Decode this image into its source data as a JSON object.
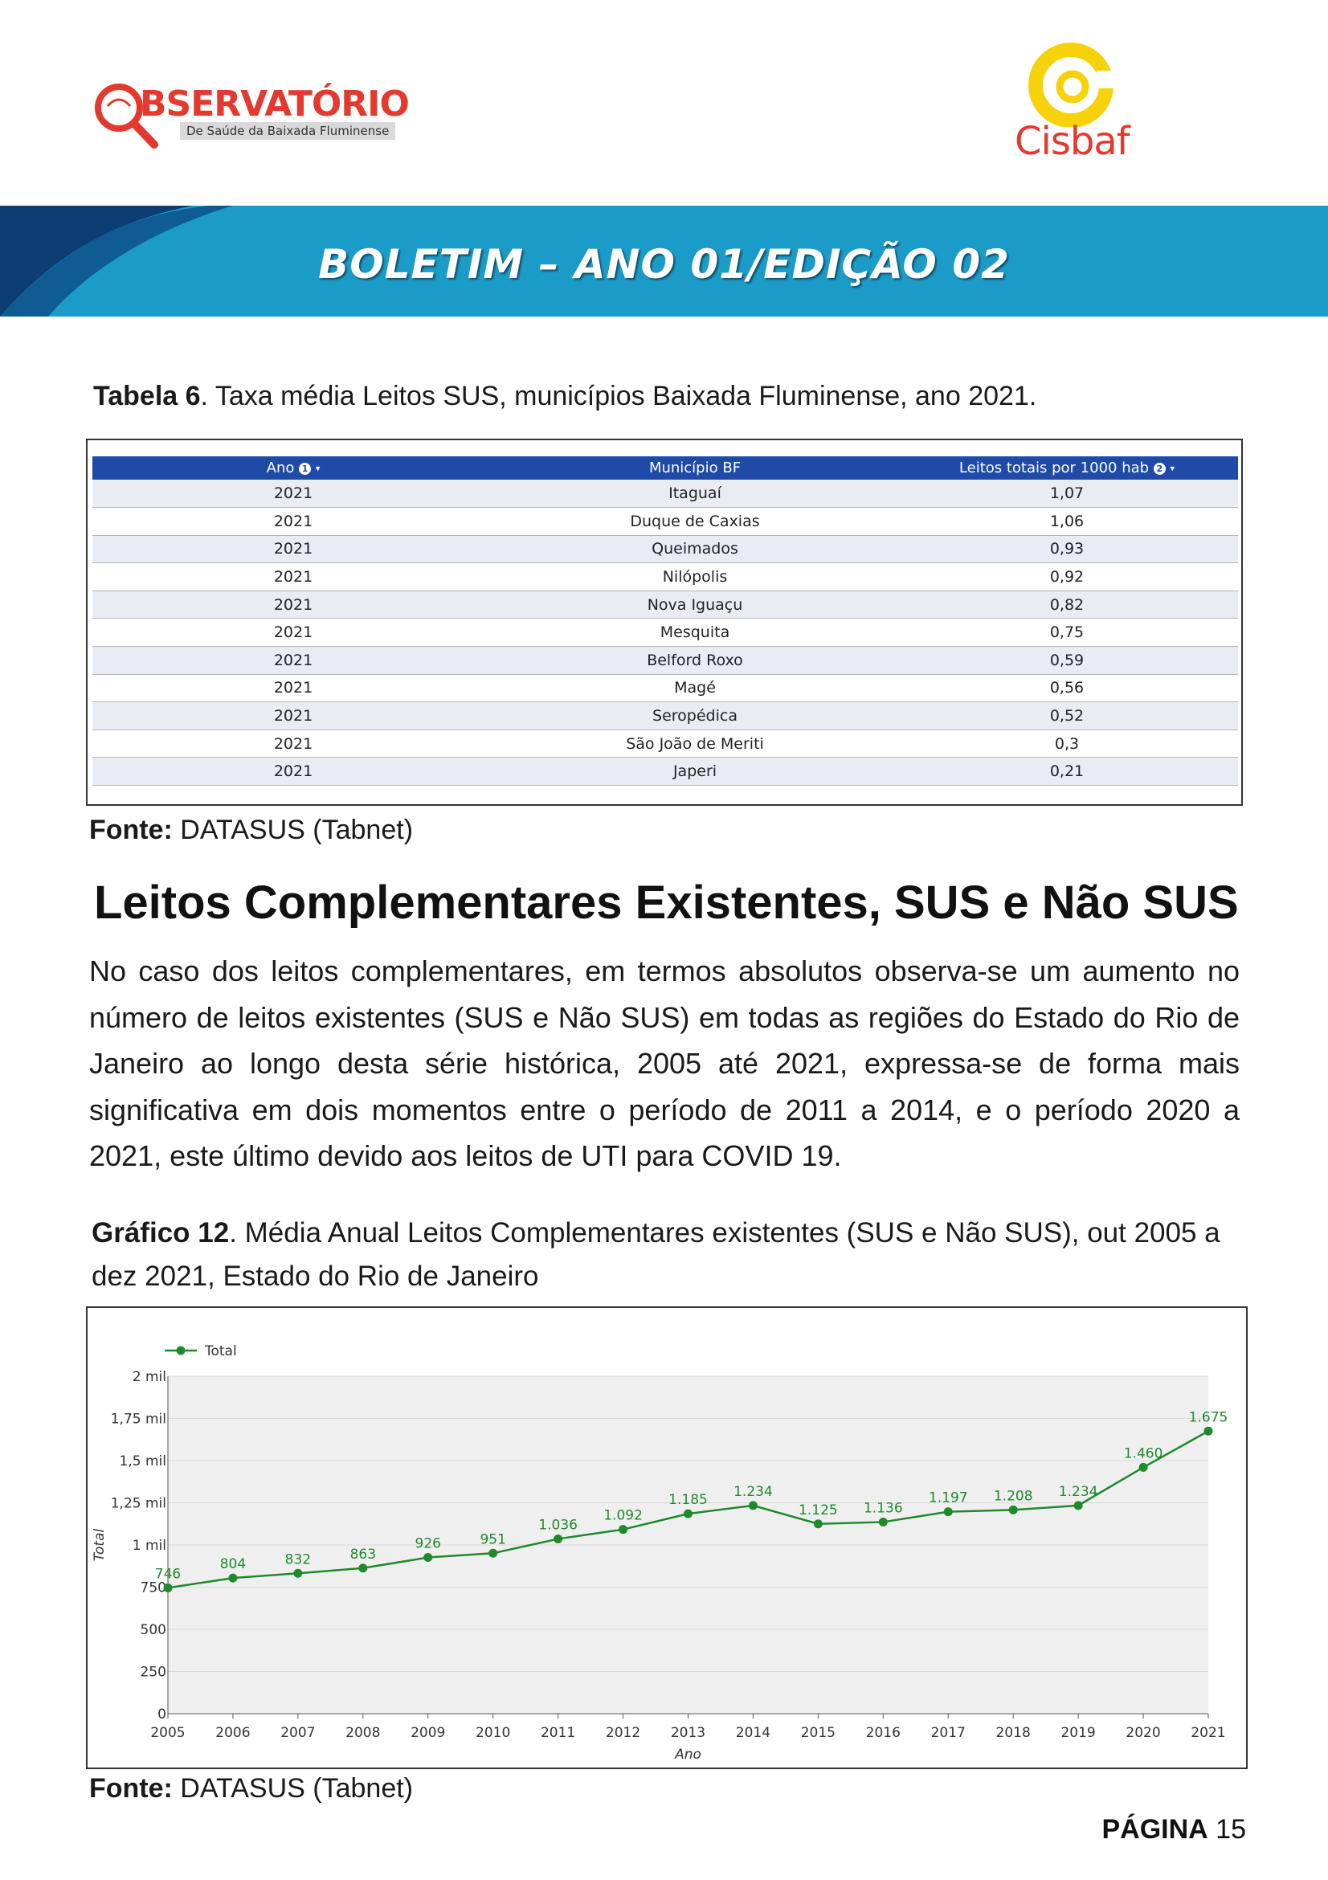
{
  "header": {
    "obs_title": "BSERVATÓRIO",
    "obs_subtitle": "De Saúde da Baixada Fluminense",
    "cisbaf": "Cisbaf",
    "banner": "BOLETIM – ANO 01/EDIÇÃO 02",
    "colors": {
      "red": "#e4392e",
      "blue": "#1b9bc8",
      "navy": "#0d3e73",
      "yellow": "#f5d20a"
    }
  },
  "table_section": {
    "caption_bold": "Tabela 6",
    "caption_rest": ". Taxa média Leitos SUS, municípios Baixada Fluminense, ano 2021.",
    "columns": [
      "Ano",
      "Município BF",
      "Leitos totais por 1000 hab"
    ],
    "column_badges": [
      "1",
      "",
      "2"
    ],
    "rows": [
      [
        "2021",
        "Itaguaí",
        "1,07"
      ],
      [
        "2021",
        "Duque de Caxias",
        "1,06"
      ],
      [
        "2021",
        "Queimados",
        "0,93"
      ],
      [
        "2021",
        "Nilópolis",
        "0,92"
      ],
      [
        "2021",
        "Nova Iguaçu",
        "0,82"
      ],
      [
        "2021",
        "Mesquita",
        "0,75"
      ],
      [
        "2021",
        "Belford Roxo",
        "0,59"
      ],
      [
        "2021",
        "Magé",
        "0,56"
      ],
      [
        "2021",
        "Seropédica",
        "0,52"
      ],
      [
        "2021",
        "São João de Meriti",
        "0,3"
      ],
      [
        "2021",
        "Japeri",
        "0,21"
      ]
    ],
    "header_color": "#1f4aa8",
    "source_bold": "Fonte:",
    "source_rest": " DATASUS (Tabnet)"
  },
  "section": {
    "heading": "Leitos Complementares Existentes, SUS e Não SUS",
    "paragraph": "No caso dos leitos complementares, em termos absolutos observa-se um aumento no número de leitos existentes (SUS e Não SUS) em todas as regiões do Estado do Rio de Janeiro ao longo desta série histórica, 2005 até 2021, expressa-se de forma mais significativa em dois momentos entre o período de 2011 a 2014,  e o período 2020 a 2021, este último devido aos leitos de UTI para COVID 19."
  },
  "chart_section": {
    "caption_bold": "Gráfico 12",
    "caption_rest": ". Média Anual Leitos Complementares existentes (SUS e Não SUS), out 2005 a dez 2021, Estado do Rio de Janeiro",
    "source_bold": "Fonte:",
    "source_rest": " DATASUS (Tabnet)"
  },
  "chart_data": {
    "type": "line",
    "x": [
      "2005",
      "2006",
      "2007",
      "2008",
      "2009",
      "2010",
      "2011",
      "2012",
      "2013",
      "2014",
      "2015",
      "2016",
      "2017",
      "2018",
      "2019",
      "2020",
      "2021"
    ],
    "series": [
      {
        "name": "Total",
        "values": [
          746,
          804,
          832,
          863,
          926,
          951,
          1036,
          1092,
          1185,
          1234,
          1125,
          1136,
          1197,
          1208,
          1234,
          1460,
          1675
        ],
        "labels": [
          "746",
          "804",
          "832",
          "863",
          "926",
          "951",
          "1.036",
          "1.092",
          "1.185",
          "1.234",
          "1.125",
          "1.136",
          "1.197",
          "1.208",
          "1.234",
          "1.460",
          "1.675"
        ],
        "color": "#1e8a2a"
      }
    ],
    "yticks": [
      {
        "value": 0,
        "label": "0"
      },
      {
        "value": 250,
        "label": "250"
      },
      {
        "value": 500,
        "label": "500"
      },
      {
        "value": 750,
        "label": "750"
      },
      {
        "value": 1000,
        "label": "1 mil"
      },
      {
        "value": 1250,
        "label": "1,25 mil"
      },
      {
        "value": 1500,
        "label": "1,5 mil"
      },
      {
        "value": 1750,
        "label": "1,75 mil"
      },
      {
        "value": 2000,
        "label": "2 mil"
      }
    ],
    "ylim": [
      0,
      2000
    ],
    "xlabel": "Ano",
    "ylabel": "Total",
    "legend": "top-left",
    "plot_background": "#efefef"
  },
  "footer": {
    "page_label": "PÁGINA",
    "page_number": "15"
  }
}
